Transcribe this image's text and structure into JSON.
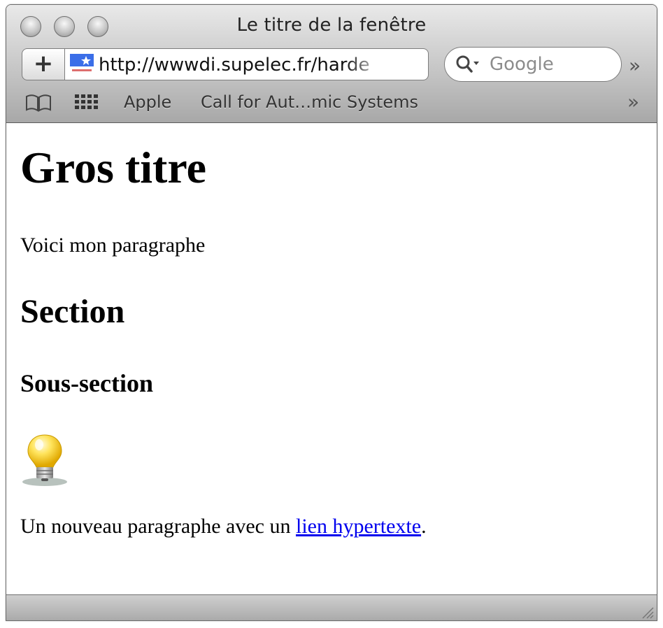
{
  "window": {
    "title": "Le titre de la fenêtre"
  },
  "toolbar": {
    "add_label": "+",
    "url": "http://wwwdi.supelec.fr/harde",
    "search_placeholder": "Google",
    "overflow_label": "»"
  },
  "bookmarks": {
    "items": [
      {
        "label": "Apple"
      },
      {
        "label": "Call for Aut…mic Systems"
      }
    ],
    "overflow_label": "»"
  },
  "page": {
    "heading": "Gros titre",
    "paragraph1": "Voici mon paragraphe",
    "section": "Section",
    "subsection": "Sous-section",
    "paragraph2_before": "Un nouveau paragraphe avec un ",
    "link_text": "lien hypertexte",
    "paragraph2_after": "."
  },
  "colors": {
    "link": "#0000ee",
    "chrome": "#bdbdbd"
  }
}
